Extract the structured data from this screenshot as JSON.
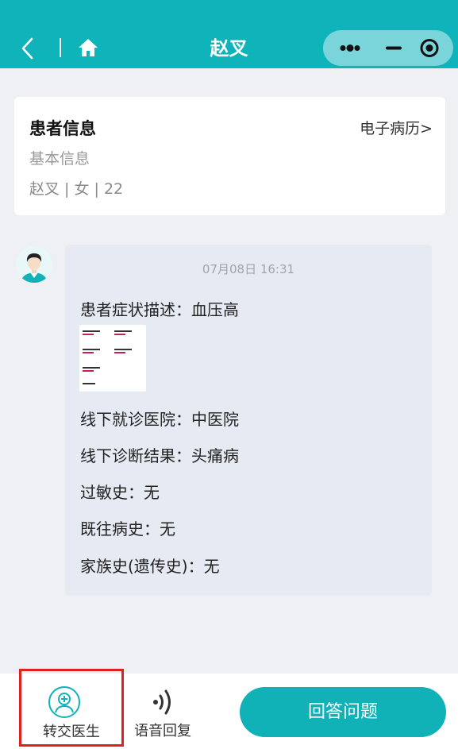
{
  "nav": {
    "title": "赵叉",
    "back_icon": "chevron-left-icon",
    "home_icon": "home-icon"
  },
  "capsule": {
    "more_icon": "more-dots-icon",
    "minimize_icon": "minimize-icon",
    "close_icon": "target-close-icon"
  },
  "patient_card": {
    "title": "患者信息",
    "ehr_link": "电子病历>",
    "subtitle": "基本信息",
    "info": "赵叉 | 女 | 22"
  },
  "message": {
    "time": "07月08日 16:31",
    "symptom": "患者症状描述：血压高",
    "hospital": "线下就诊医院：中医院",
    "diagnosis": "线下诊断结果：头痛病",
    "allergy": "过敏史：无",
    "past_history": "既往病史：无",
    "family_history": "家族史(遗传史)：无"
  },
  "bottom": {
    "transfer_label": "转交医生",
    "voice_label": "语音回复",
    "answer_label": "回答问题"
  },
  "colors": {
    "brand": "#0fb3ba",
    "highlight_border": "#e0221f"
  }
}
